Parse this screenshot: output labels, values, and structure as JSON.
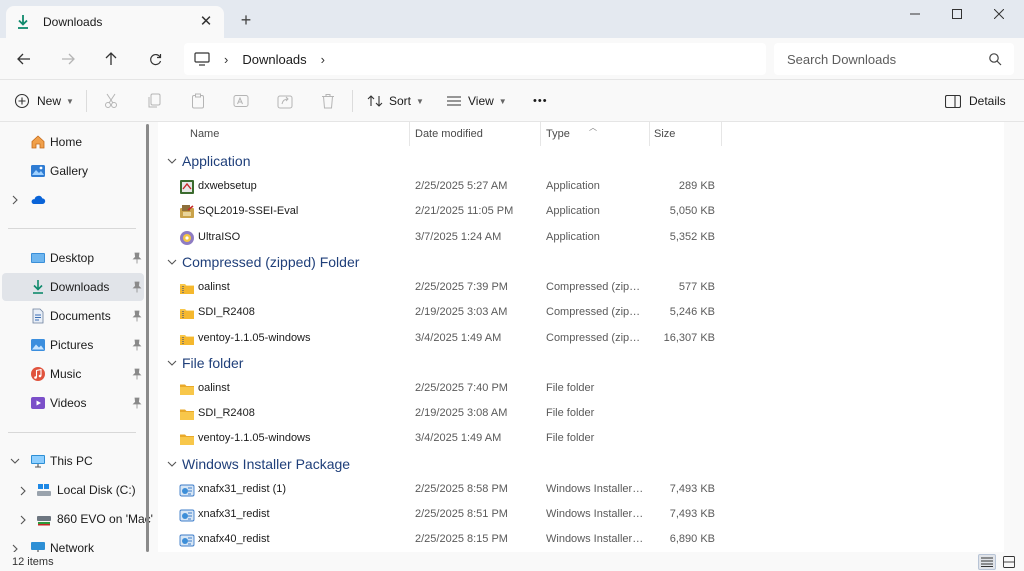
{
  "tab": {
    "title": "Downloads"
  },
  "address": {
    "crumb": "Downloads",
    "separator": "›"
  },
  "search": {
    "placeholder": "Search Downloads"
  },
  "commands": {
    "new_label": "New",
    "sort_label": "Sort",
    "view_label": "View",
    "more_label": "•••",
    "details_label": "Details"
  },
  "nav": {
    "home": "Home",
    "gallery": "Gallery",
    "desktop": "Desktop",
    "downloads": "Downloads",
    "documents": "Documents",
    "pictures": "Pictures",
    "music": "Music",
    "videos": "Videos",
    "this_pc": "This PC",
    "local_disk": "Local Disk (C:)",
    "evo": "860 EVO on 'Mac'",
    "network": "Network"
  },
  "columns": {
    "name": "Name",
    "date": "Date modified",
    "type": "Type",
    "size": "Size"
  },
  "groups": [
    {
      "label": "Application",
      "files": [
        {
          "name": "dxwebsetup",
          "date": "2/25/2025 5:27 AM",
          "type": "Application",
          "size": "289 KB",
          "icon": "installer-icon"
        },
        {
          "name": "SQL2019-SSEI-Eval",
          "date": "2/21/2025 11:05 PM",
          "type": "Application",
          "size": "5,050 KB",
          "icon": "sql-setup-icon"
        },
        {
          "name": "UltraISO",
          "date": "3/7/2025 1:24 AM",
          "type": "Application",
          "size": "5,352 KB",
          "icon": "disc-icon"
        }
      ]
    },
    {
      "label": "Compressed (zipped) Folder",
      "files": [
        {
          "name": "oalinst",
          "date": "2/25/2025 7:39 PM",
          "type": "Compressed (zipp...",
          "size": "577 KB",
          "icon": "zip-folder-icon"
        },
        {
          "name": "SDI_R2408",
          "date": "2/19/2025 3:03 AM",
          "type": "Compressed (zipp...",
          "size": "5,246 KB",
          "icon": "zip-folder-icon"
        },
        {
          "name": "ventoy-1.1.05-windows",
          "date": "3/4/2025 1:49 AM",
          "type": "Compressed (zipp...",
          "size": "16,307 KB",
          "icon": "zip-folder-icon"
        }
      ]
    },
    {
      "label": "File folder",
      "files": [
        {
          "name": "oalinst",
          "date": "2/25/2025 7:40 PM",
          "type": "File folder",
          "size": "",
          "icon": "folder-icon"
        },
        {
          "name": "SDI_R2408",
          "date": "2/19/2025 3:08 AM",
          "type": "File folder",
          "size": "",
          "icon": "folder-icon"
        },
        {
          "name": "ventoy-1.1.05-windows",
          "date": "3/4/2025 1:49 AM",
          "type": "File folder",
          "size": "",
          "icon": "folder-icon"
        }
      ]
    },
    {
      "label": "Windows Installer Package",
      "files": [
        {
          "name": "xnafx31_redist (1)",
          "date": "2/25/2025 8:58 PM",
          "type": "Windows Installer ...",
          "size": "7,493 KB",
          "icon": "msi-icon"
        },
        {
          "name": "xnafx31_redist",
          "date": "2/25/2025 8:51 PM",
          "type": "Windows Installer ...",
          "size": "7,493 KB",
          "icon": "msi-icon"
        },
        {
          "name": "xnafx40_redist",
          "date": "2/25/2025 8:15 PM",
          "type": "Windows Installer ...",
          "size": "6,890 KB",
          "icon": "msi-icon"
        }
      ]
    }
  ],
  "status": {
    "count": "12 items"
  },
  "colors": {
    "accent": "#0067c0",
    "group_header": "#1f3f7a",
    "selected": "#e1e4e9",
    "folder": "#f8c74a"
  }
}
